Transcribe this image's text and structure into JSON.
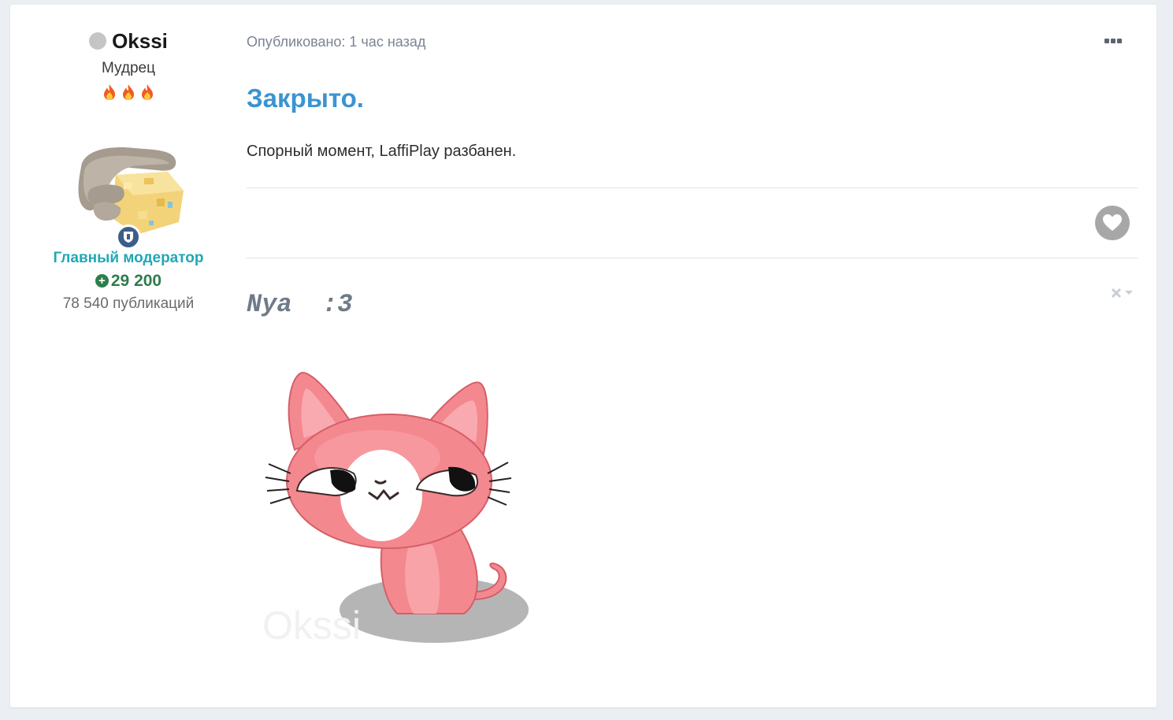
{
  "author": {
    "name": "Okssi",
    "status": "offline",
    "title": "Мудрец",
    "flames": 3,
    "group": "Главный модератор",
    "reputation": "29 200",
    "posts": "78 540 публикаций"
  },
  "post": {
    "meta": "Опубликовано: 1 час назад",
    "heading": "Закрыто.",
    "text": "Спорный момент, LaffiPlay разбанен."
  },
  "signature": {
    "text": "Nya  :3",
    "watermark": "Okssi"
  },
  "colors": {
    "heading": "#3a94d1",
    "group": "#1fa8b5",
    "reputation": "#2e7d4c",
    "cat_pink": "#f4888f"
  },
  "icons": {
    "status": "status-dot-icon",
    "more": "ellipsis-icon",
    "like": "heart-icon",
    "mod": "shield-icon",
    "rep": "plus-circle-icon",
    "sig_close": "close-icon"
  }
}
